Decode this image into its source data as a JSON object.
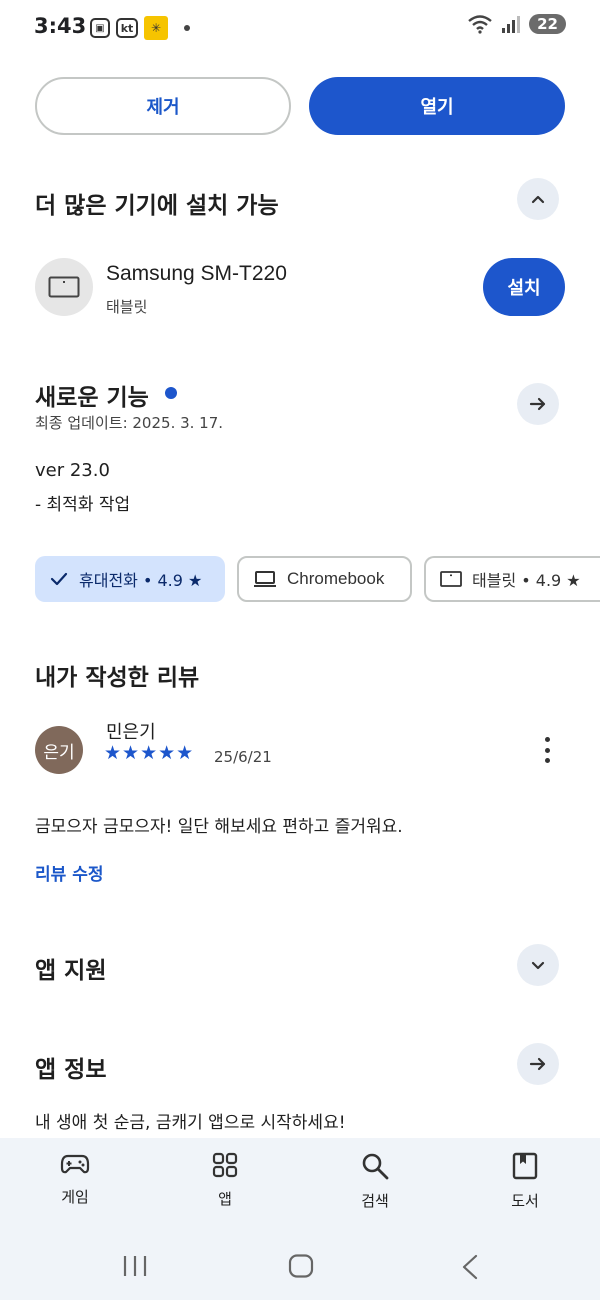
{
  "status_bar": {
    "time": "3:43",
    "kt_label": "kt",
    "battery": "22"
  },
  "actions": {
    "remove_label": "제거",
    "open_label": "열기"
  },
  "install_other": {
    "title": "더 많은 기기에 설치 가능",
    "device_name": "Samsung SM-T220",
    "device_type": "태블릿",
    "install_label": "설치"
  },
  "whats_new": {
    "title": "새로운 기능",
    "updated": "최종 업데이트: 2025. 3. 17.",
    "version": "ver 23.0",
    "note": "- 최적화 작업"
  },
  "device_chips": [
    {
      "label": "휴대전화 • 4.9 ★",
      "selected": true,
      "icon": "check-icon"
    },
    {
      "label": "Chromebook",
      "selected": false,
      "icon": "laptop-icon"
    },
    {
      "label": "태블릿 • 4.9 ★",
      "selected": false,
      "icon": "tablet-icon"
    }
  ],
  "my_review": {
    "title": "내가 작성한 리뷰",
    "avatar_text": "은기",
    "reviewer": "민은기",
    "stars": "★★★★★",
    "rating": 5,
    "date": "25/6/21",
    "text": "금모으자 금모으자! 일단 해보세요 편하고 즐거워요.",
    "edit_label": "리뷰 수정"
  },
  "app_support": {
    "title": "앱 지원"
  },
  "app_info": {
    "title": "앱 정보",
    "text": "내 생애 첫 순금, 금캐기 앱으로 시작하세요!"
  },
  "bottom_nav": [
    {
      "label": "게임",
      "icon": "gamepad-icon"
    },
    {
      "label": "앱",
      "icon": "apps-grid-icon"
    },
    {
      "label": "검색",
      "icon": "search-icon"
    },
    {
      "label": "도서",
      "icon": "book-icon"
    }
  ],
  "colors": {
    "accent": "#1d56cc",
    "chip_selected": "#d3e3fd",
    "nav_bg": "#f0f4f9",
    "avatar": "#80695b"
  }
}
